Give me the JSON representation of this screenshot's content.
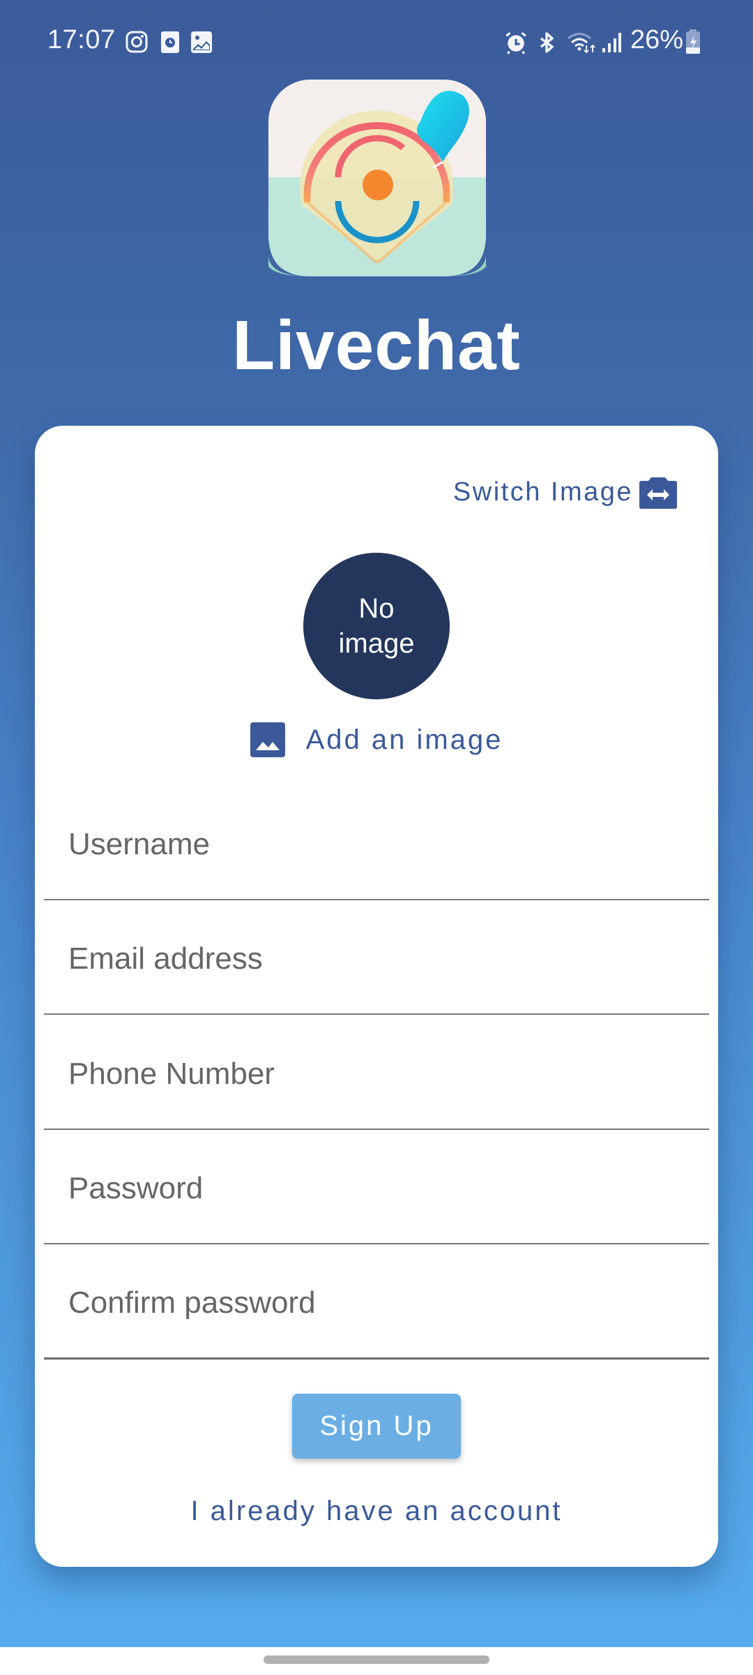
{
  "status_bar": {
    "time": "17:07",
    "left_icons": [
      "instagram-icon",
      "clock-notification-icon",
      "gallery-notification-icon"
    ],
    "right_icons": [
      "alarm-icon",
      "bluetooth-icon",
      "wifi-icon",
      "signal-icon"
    ],
    "battery_percent": "26%",
    "battery_state": "charging"
  },
  "app": {
    "title": "Livechat",
    "logo": "livechat-logo-icon"
  },
  "card": {
    "switch_image_label": "Switch Image",
    "avatar_placeholder_line1": "No",
    "avatar_placeholder_line2": "image",
    "add_image_label": "Add an image",
    "fields": [
      {
        "name": "username",
        "placeholder": "Username",
        "value": ""
      },
      {
        "name": "email",
        "placeholder": "Email address",
        "value": ""
      },
      {
        "name": "phone",
        "placeholder": "Phone Number",
        "value": ""
      },
      {
        "name": "password",
        "placeholder": "Password",
        "value": ""
      },
      {
        "name": "confirm-password",
        "placeholder": "Confirm password",
        "value": ""
      }
    ],
    "signup_label": "Sign Up",
    "login_link_label": "I already have an account"
  },
  "colors": {
    "accent": "#3b5998",
    "button": "#6aaee3",
    "avatar": "#24365c",
    "background_top": "#3c5b9a",
    "background_bottom": "#55abec"
  }
}
